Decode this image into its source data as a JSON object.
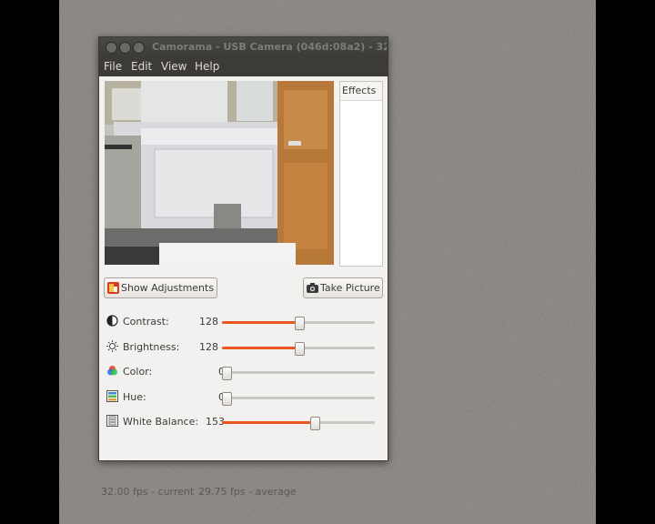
{
  "window": {
    "title": "Camorama - USB Camera (046d:08a2) - 32",
    "menu": [
      "File",
      "Edit",
      "View",
      "Help"
    ]
  },
  "effects": {
    "header": "Effects"
  },
  "buttons": {
    "show_adjustments": "Show Adjustments",
    "take_picture": "Take Picture"
  },
  "adjustments": [
    {
      "label": "Contrast:",
      "value": "128",
      "fraction": 0.502,
      "icon": "contrast-icon"
    },
    {
      "label": "Brightness:",
      "value": "128",
      "fraction": 0.502,
      "icon": "brightness-icon"
    },
    {
      "label": "Color:",
      "value": "0",
      "fraction": 0.0,
      "icon": "color-icon"
    },
    {
      "label": "Hue:",
      "value": "0",
      "fraction": 0.0,
      "icon": "hue-icon"
    },
    {
      "label": "White Balance:",
      "value": "153",
      "fraction": 0.6,
      "icon": "white-balance-icon"
    }
  ],
  "status": {
    "current": "32.00 fps - current",
    "average": "29.75 fps - average"
  },
  "colors": {
    "slider_fill": "#e9561f",
    "titlebar": "#3c3b37"
  }
}
